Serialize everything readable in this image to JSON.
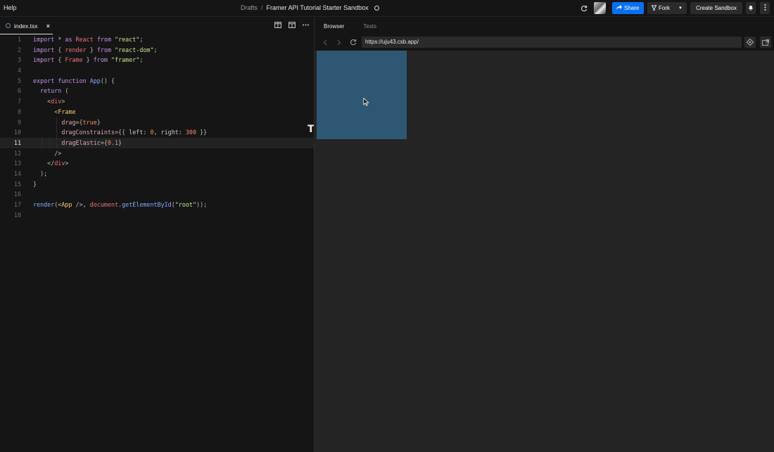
{
  "menu": {
    "help": "Help"
  },
  "breadcrumb": {
    "drafts": "Drafts",
    "separator": "/",
    "title": "Framer API Tutorial Starter Sandbox"
  },
  "toolbar": {
    "share_label": "Share",
    "fork_label": "Fork",
    "create_label": "Create Sandbox"
  },
  "editor": {
    "tab_label": "index.tsx",
    "close_glyph": "×",
    "active_line": 11,
    "lines": [
      "import * as React from \"react\";",
      "import { render } from \"react-dom\";",
      "import { Frame } from \"framer\";",
      "",
      "export function App() {",
      "  return (",
      "    <div>",
      "      <Frame",
      "        drag={true}",
      "        dragConstraints={{ left: 0, right: 300 }}",
      "        dragElastic={0.1}",
      "      />",
      "    </div>",
      "  );",
      "}",
      "",
      "render(<App />, document.getElementById(\"root\"));",
      ""
    ],
    "line_numbers": [
      "1",
      "2",
      "3",
      "4",
      "5",
      "6",
      "7",
      "8",
      "9",
      "10",
      "11",
      "12",
      "13",
      "14",
      "15",
      "16",
      "17",
      "18"
    ]
  },
  "preview": {
    "tab_browser": "Browser",
    "tab_tests": "Tests",
    "url": "https://uju43.csb.app/",
    "frame_color": "#2e5773"
  },
  "colors": {
    "accent": "#0971f1",
    "background": "#151515",
    "viewport": "#242424"
  },
  "icons": [
    "refresh-icon",
    "share-icon",
    "fork-icon",
    "bell-icon",
    "more-vertical-icon",
    "file-icon",
    "close-icon",
    "split-view-icon",
    "layout-icon",
    "more-horizontal-icon",
    "back-arrow-icon",
    "forward-arrow-icon",
    "reload-icon",
    "devtools-icon",
    "open-new-window-icon",
    "text-cursor-icon",
    "pointer-cursor-icon"
  ]
}
